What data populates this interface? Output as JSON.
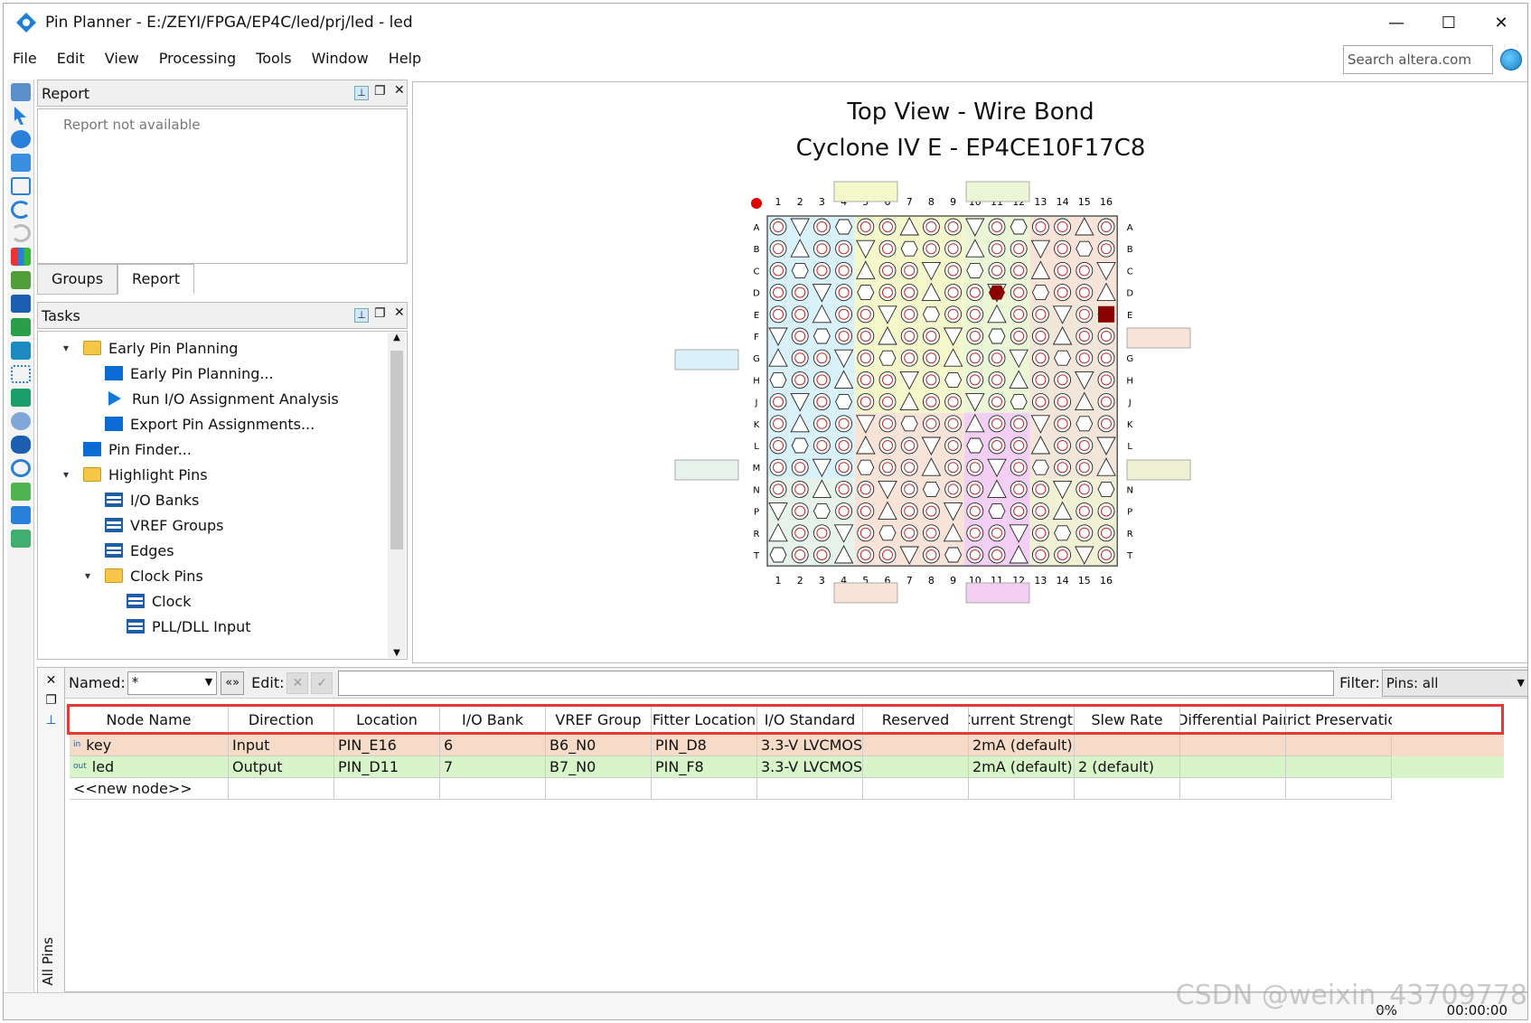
{
  "window": {
    "title": "Pin Planner - E:/ZEYI/FPGA/EP4C/led/prj/led - led",
    "minimize": "—",
    "maximize": "☐",
    "close": "✕"
  },
  "menu": [
    "File",
    "Edit",
    "View",
    "Processing",
    "Tools",
    "Window",
    "Help"
  ],
  "search": {
    "placeholder": "Search altera.com"
  },
  "report_panel": {
    "title": "Report",
    "body": "Report not available"
  },
  "tabs": [
    "Groups",
    "Report"
  ],
  "tasks_panel": {
    "title": "Tasks",
    "items": [
      "Early Pin Planning",
      "Early Pin Planning...",
      "Run I/O Assignment Analysis",
      "Export Pin Assignments...",
      "Pin Finder...",
      "Highlight Pins",
      "I/O Banks",
      "VREF Groups",
      "Edges",
      "Clock Pins",
      "Clock",
      "PLL/DLL Input"
    ]
  },
  "chip_view": {
    "title": "Top View - Wire Bond",
    "subtitle": "Cyclone IV E - EP4CE10F17C8",
    "columns": [
      "1",
      "2",
      "3",
      "4",
      "5",
      "6",
      "7",
      "8",
      "9",
      "10",
      "11",
      "12",
      "13",
      "14",
      "15",
      "16"
    ],
    "rows": [
      "A",
      "B",
      "C",
      "D",
      "E",
      "F",
      "G",
      "H",
      "J",
      "K",
      "L",
      "M",
      "N",
      "P",
      "R",
      "T"
    ]
  },
  "filter_bar": {
    "named_label": "Named:",
    "named_value": "*",
    "edit_label": "Edit:",
    "filter_label": "Filter:",
    "filter_value": "Pins: all"
  },
  "side_label": "All Pins",
  "grid": {
    "headers": [
      "Node Name",
      "Direction",
      "Location",
      "I/O Bank",
      "VREF Group",
      "Fitter Location",
      "I/O Standard",
      "Reserved",
      "Current Strength",
      "Slew Rate",
      "Differential Pair",
      "Strict Preservation"
    ],
    "rows": [
      {
        "node": "key",
        "dir_icon": "in",
        "direction": "Input",
        "location": "PIN_E16",
        "io_bank": "6",
        "vref": "B6_N0",
        "fitter": "PIN_D8",
        "standard": "3.3-V LVCMOS",
        "reserved": "",
        "current": "2mA (default)",
        "slew": "",
        "diff": "",
        "strict": ""
      },
      {
        "node": "led",
        "dir_icon": "out",
        "direction": "Output",
        "location": "PIN_D11",
        "io_bank": "7",
        "vref": "B7_N0",
        "fitter": "PIN_F8",
        "standard": "3.3-V LVCMOS",
        "reserved": "",
        "current": "2mA (default)",
        "slew": "2 (default)",
        "diff": "",
        "strict": ""
      }
    ],
    "new_node": "<<new node>>"
  },
  "status": {
    "percent": "0%",
    "time": "00:00:00"
  },
  "watermark": "CSDN @weixin_43709778",
  "colors": {
    "selection_border": "#e53935",
    "key_row": "#f6dcc8",
    "led_row": "#d8f5c9",
    "pin_circle": "#c62828"
  }
}
